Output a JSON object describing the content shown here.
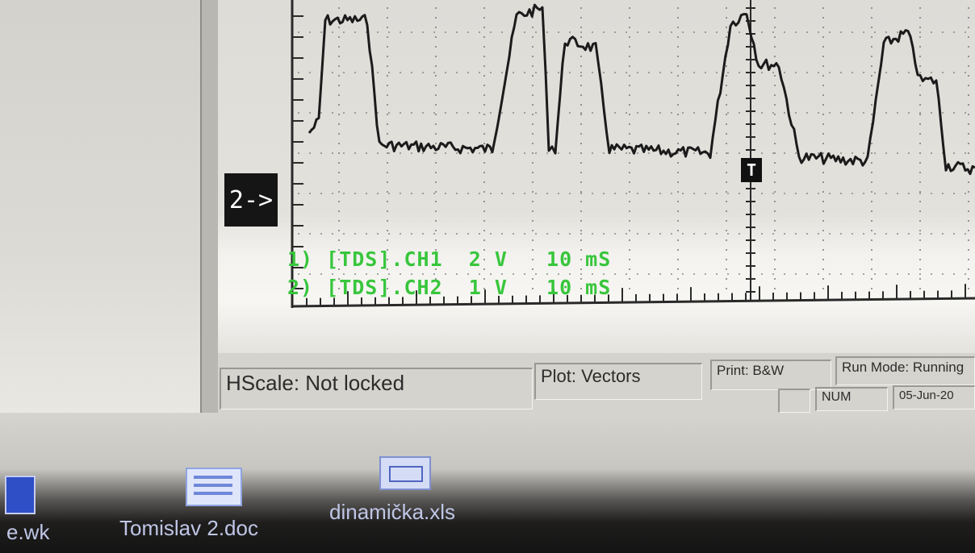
{
  "scope": {
    "channel_marker": "2->",
    "trigger_marker": "T",
    "legend": [
      "1) [TDS].CH1  2 V   10 mS",
      "2) [TDS].CH2  1 V   10 mS"
    ],
    "trace_color": "#1b1b1b",
    "legend_color": "#38c63c"
  },
  "status_bar": {
    "hscale": "HScale: Not locked",
    "plot": "Plot: Vectors",
    "print": "Print: B&W",
    "run_mode": "Run Mode: Running",
    "num": "NUM",
    "date": "05-Jun-20"
  },
  "desktop": {
    "files": [
      {
        "label": "e.wk",
        "icon": "document-icon"
      },
      {
        "label": "Tomislav 2.doc",
        "icon": "word-document-icon"
      },
      {
        "label": "dinamička.xls",
        "icon": "spreadsheet-icon"
      }
    ]
  }
}
